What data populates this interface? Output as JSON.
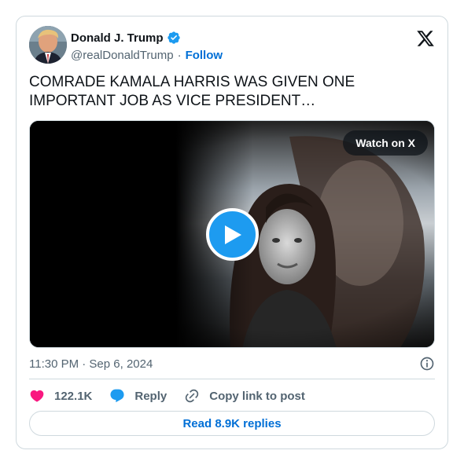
{
  "author": {
    "display_name": "Donald J. Trump",
    "handle": "@realDonaldTrump",
    "separator": "·",
    "follow_label": "Follow",
    "verified_icon": "verified-badge-icon",
    "avatar": "profile-photo"
  },
  "brand_icon": "x-logo-icon",
  "tweet": {
    "text": "COMRADE KAMALA HARRIS WAS GIVEN ONE IMPORTANT JOB AS VICE PRESIDENT…"
  },
  "media": {
    "type": "video",
    "watch_label": "Watch on X",
    "play_icon": "play-icon"
  },
  "meta": {
    "timestamp": "11:30 PM · Sep 6, 2024",
    "info_icon": "info-icon"
  },
  "actions": {
    "like_count": "122.1K",
    "reply_label": "Reply",
    "copy_label": "Copy link to post"
  },
  "footer": {
    "read_replies_label": "Read 8.9K replies"
  },
  "colors": {
    "accent": "#1d9bf0",
    "link": "#006fd6",
    "like": "#f91880",
    "secondary_text": "#536471",
    "border": "#cfd9de"
  }
}
